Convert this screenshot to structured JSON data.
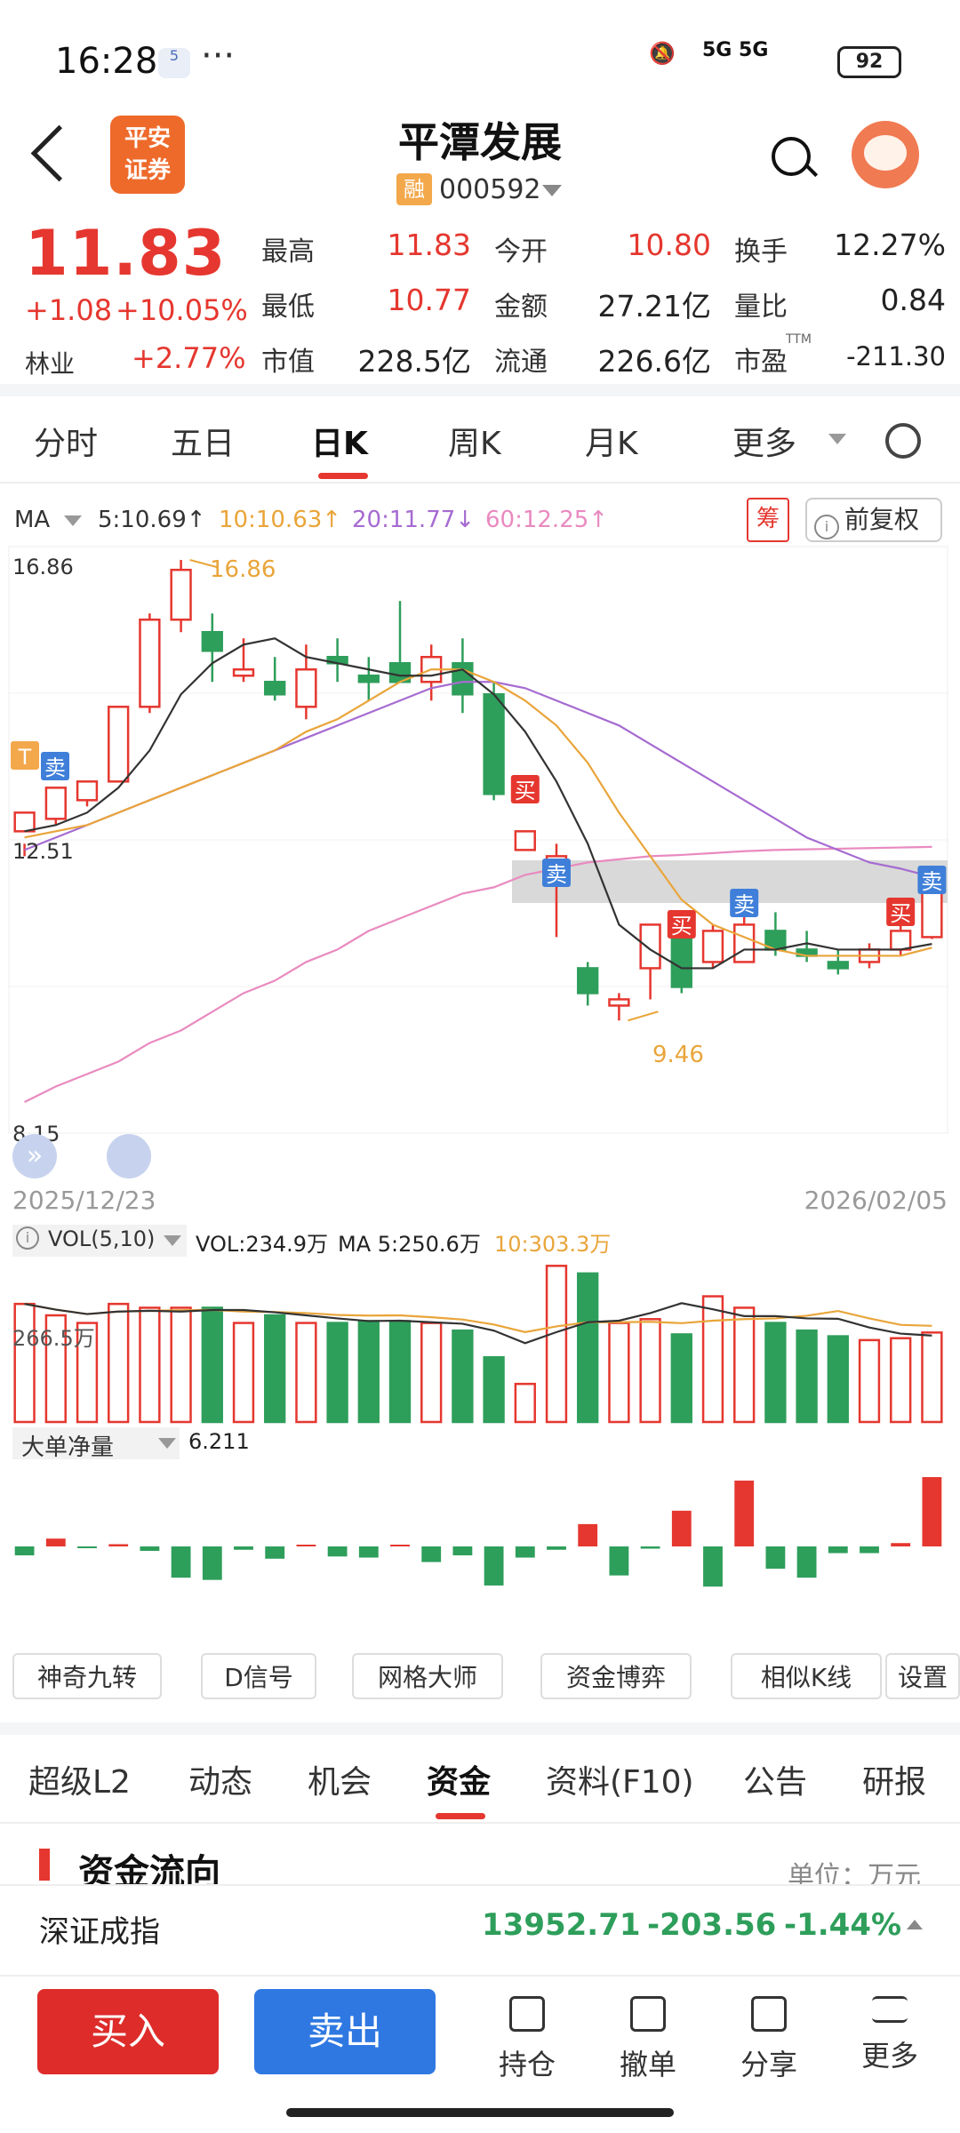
{
  "status_bar": {
    "time": "16:28",
    "badge": "5",
    "dots": "···",
    "signal": "5G 5G",
    "battery": "92"
  },
  "header": {
    "stock_name": "平潭发展",
    "margin_tag": "融",
    "code": "000592",
    "logo_text": "平安\n证券"
  },
  "quote": {
    "price": "11.83",
    "change": "+1.08",
    "change_pct": "+10.05%",
    "industry": "林业",
    "industry_pct": "+2.77%",
    "fields": [
      {
        "label": "最高",
        "value": "11.83",
        "color": "red"
      },
      {
        "label": "今开",
        "value": "10.80",
        "color": "red"
      },
      {
        "label": "换手",
        "value": "12.27%",
        "color": "normal"
      },
      {
        "label": "最低",
        "value": "10.77",
        "color": "red"
      },
      {
        "label": "金额",
        "value": "27.21亿",
        "color": "normal"
      },
      {
        "label": "量比",
        "value": "0.84",
        "color": "normal"
      },
      {
        "label": "市值",
        "value": "228.5亿",
        "color": "normal"
      },
      {
        "label": "流通",
        "value": "226.6亿",
        "color": "normal"
      },
      {
        "label": "市盈",
        "value": "-211.30",
        "color": "normal",
        "sup": "TTM"
      }
    ]
  },
  "kline_tabs": [
    "分时",
    "五日",
    "日K",
    "周K",
    "月K",
    "更多"
  ],
  "active_tab": "日K",
  "ma_legend": {
    "label": "MA",
    "ma5": "5:10.69↑",
    "ma10": "10:10.63↑",
    "ma20": "20:11.77↓",
    "ma60": "60:12.25↑"
  },
  "chips_btn": "筹",
  "adjust_btn": "前复权",
  "chart_labels": {
    "max": "16.86",
    "mid": "12.51",
    "min": "8.15",
    "high_mark": "16.86",
    "low_mark": "9.46",
    "date_start": "2025/12/23",
    "date_end": "2026/02/05"
  },
  "vol_legend": {
    "label": "VOL(5,10)",
    "vol": "VOL:234.9万",
    "ma5": "MA 5:250.6万",
    "ma10": "10:303.3万",
    "axis": "266.5万"
  },
  "big_order": {
    "label": "大单净量",
    "value": "6.211"
  },
  "signals": {
    "buy": "买",
    "sell": "卖",
    "t": "T"
  },
  "tool_buttons": [
    "神奇九转",
    "D信号",
    "网格大师",
    "资金博弈",
    "相似K线",
    "设置"
  ],
  "bottom_tabs": [
    "超级L2",
    "动态",
    "机会",
    "资金",
    "资料(F10)",
    "公告",
    "研报"
  ],
  "active_bottom_tab": "资金",
  "section": {
    "title": "资金流向",
    "unit": "单位：万元"
  },
  "index": {
    "name": "深证成指",
    "value": "13952.71",
    "change": "-203.56",
    "pct": "-1.44%"
  },
  "actions": {
    "buy": "买入",
    "sell": "卖出",
    "items": [
      "持仓",
      "撤单",
      "分享",
      "更多"
    ]
  },
  "colors": {
    "up": "#e5372f",
    "down": "#2e9e5b",
    "ma5": "#333333",
    "ma10": "#e9a53a",
    "ma20": "#a66bd1",
    "ma60": "#e98ac0"
  },
  "chart_data": {
    "type": "candlestick",
    "ylim": [
      8.15,
      16.86
    ],
    "ohlc": [
      [
        12.5,
        12.8,
        12.3,
        12.1
      ],
      [
        12.7,
        13.2,
        13.2,
        12.6
      ],
      [
        13.0,
        13.3,
        13.3,
        12.9
      ],
      [
        13.3,
        14.5,
        14.5,
        13.3
      ],
      [
        14.5,
        15.9,
        16.0,
        14.4
      ],
      [
        15.9,
        16.7,
        16.86,
        15.7
      ],
      [
        15.7,
        15.4,
        16.0,
        14.9
      ],
      [
        15.0,
        15.1,
        15.6,
        14.9
      ],
      [
        14.9,
        14.7,
        15.3,
        14.6
      ],
      [
        14.5,
        15.1,
        15.5,
        14.3
      ],
      [
        15.3,
        15.2,
        15.6,
        14.9
      ],
      [
        15.0,
        14.9,
        15.3,
        14.6
      ],
      [
        15.2,
        14.9,
        16.2,
        14.9
      ],
      [
        14.9,
        15.3,
        15.5,
        14.6
      ],
      [
        15.2,
        14.7,
        15.6,
        14.4
      ],
      [
        14.7,
        13.1,
        14.9,
        13.0
      ],
      [
        12.2,
        12.5,
        12.5,
        12.2
      ],
      [
        11.7,
        12.1,
        12.3,
        10.8
      ],
      [
        10.3,
        9.9,
        10.4,
        9.7
      ],
      [
        9.7,
        9.8,
        9.9,
        9.46
      ],
      [
        10.3,
        11.0,
        11.0,
        9.8
      ],
      [
        11.0,
        10.0,
        11.1,
        9.9
      ],
      [
        10.4,
        10.9,
        11.0,
        10.3
      ],
      [
        10.4,
        11.0,
        11.4,
        10.4
      ],
      [
        10.9,
        10.6,
        11.2,
        10.5
      ],
      [
        10.6,
        10.5,
        10.9,
        10.4
      ],
      [
        10.4,
        10.3,
        10.6,
        10.2
      ],
      [
        10.4,
        10.6,
        10.7,
        10.3
      ],
      [
        10.6,
        10.9,
        11.4,
        10.5
      ],
      [
        10.8,
        11.83,
        11.83,
        10.77
      ]
    ],
    "ma5": [
      12.5,
      12.6,
      12.8,
      13.2,
      13.8,
      14.7,
      15.2,
      15.5,
      15.6,
      15.3,
      15.2,
      15.1,
      15.0,
      15.0,
      15.1,
      14.7,
      14.1,
      13.3,
      12.3,
      11.0,
      10.6,
      10.3,
      10.3,
      10.6,
      10.6,
      10.7,
      10.6,
      10.6,
      10.6,
      10.69
    ],
    "ma10": [
      12.4,
      12.5,
      12.6,
      12.8,
      13.0,
      13.2,
      13.4,
      13.6,
      13.8,
      14.1,
      14.3,
      14.6,
      14.9,
      15.1,
      15.1,
      14.9,
      14.6,
      14.2,
      13.6,
      12.8,
      12.1,
      11.4,
      11.0,
      10.8,
      10.6,
      10.5,
      10.5,
      10.5,
      10.5,
      10.63
    ],
    "ma20": [
      12.2,
      12.4,
      12.6,
      12.8,
      13.0,
      13.2,
      13.4,
      13.6,
      13.8,
      14.0,
      14.2,
      14.4,
      14.6,
      14.8,
      14.9,
      14.9,
      14.8,
      14.6,
      14.4,
      14.2,
      13.9,
      13.6,
      13.3,
      13.0,
      12.7,
      12.4,
      12.2,
      12.0,
      11.9,
      11.77
    ],
    "ma60": [
      8.15,
      8.4,
      8.6,
      8.8,
      9.1,
      9.3,
      9.6,
      9.9,
      10.1,
      10.4,
      10.6,
      10.9,
      11.1,
      11.3,
      11.5,
      11.6,
      11.8,
      11.9,
      12.0,
      12.05,
      12.1,
      12.12,
      12.15,
      12.18,
      12.2,
      12.21,
      12.22,
      12.23,
      12.24,
      12.25
    ],
    "volume": [
      310,
      280,
      260,
      310,
      300,
      300,
      300,
      260,
      280,
      260,
      260,
      265,
      265,
      260,
      240,
      170,
      100,
      410,
      390,
      260,
      270,
      230,
      330,
      300,
      260,
      240,
      225,
      215,
      220,
      234.9
    ],
    "big_order_net": [
      -0.8,
      0.7,
      -0.1,
      0.2,
      -0.4,
      -2.8,
      -3.0,
      -0.3,
      -1.1,
      0,
      -0.9,
      -1.0,
      0,
      -1.4,
      -0.8,
      -3.5,
      -1.0,
      -0.3,
      2.0,
      -2.6,
      -0.2,
      3.2,
      -3.6,
      5.9,
      -2.0,
      -2.8,
      -0.6,
      -0.6,
      0.3,
      6.211
    ]
  }
}
